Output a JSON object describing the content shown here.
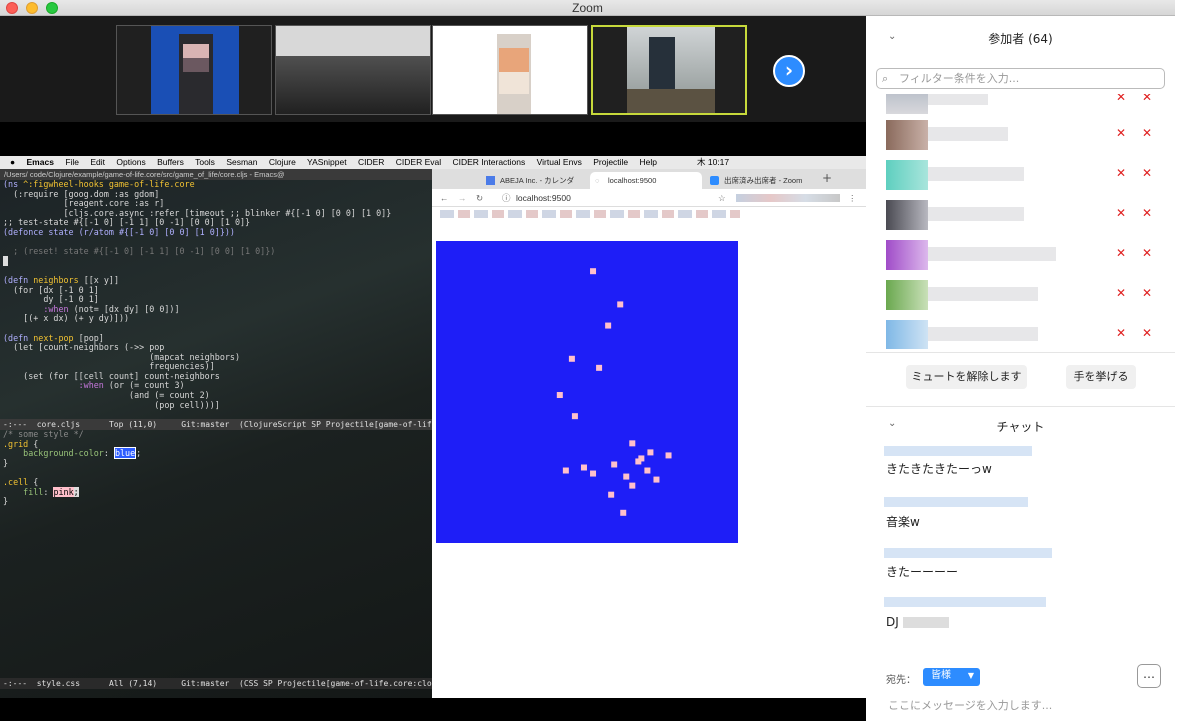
{
  "window": {
    "title": "Zoom"
  },
  "share": {
    "menubar": [
      "Emacs",
      "File",
      "Edit",
      "Options",
      "Buffers",
      "Tools",
      "Sesman",
      "Clojure",
      "YASnippet",
      "CIDER",
      "CIDER Eval",
      "CIDER Interactions",
      "Virtual Envs",
      "Projectile",
      "Help"
    ],
    "menubar_time": "木 10:17",
    "frame_title": "/Users/          code/Clojure/example/game-of-life.core/src/game_of_life/core.cljs - Emacs@",
    "modeline1": "-:---  core.cljs      Top (11,0)     Git:master  (ClojureScript SP Projectile[game-of-life",
    "modeline2": "-:---  style.css      All (7,14)     Git:master  (CSS SP Projectile[game-of-life.core:cloj",
    "browser": {
      "tabs": [
        "ABEJA Inc. - カレンダ",
        "localhost:9500",
        "出席済み出席者 - Zoom"
      ],
      "url": "localhost:9500"
    }
  },
  "participants": {
    "header": "参加者 (64)",
    "filter_placeholder": "フィルター条件を入力...",
    "unmute": "ミュートを解除します",
    "raise_hand": "手を挙げる"
  },
  "chat": {
    "header": "チャット",
    "messages": [
      "きたきたきたーっw",
      "音楽w",
      "きたーーーー",
      "DJ"
    ],
    "to_label": "宛先：",
    "to_value": "皆様",
    "input_placeholder": "ここにメッセージを入力します..."
  }
}
